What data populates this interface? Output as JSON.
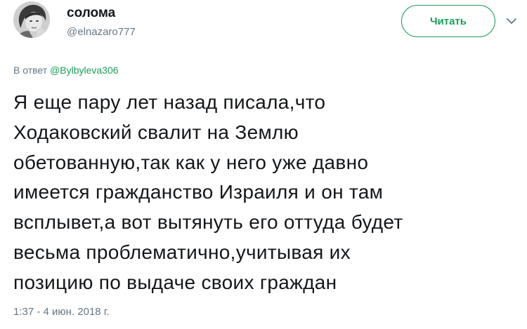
{
  "author": {
    "display_name": "солома",
    "handle": "@elnazaro777",
    "avatar_icon": "grayscale-portrait-avatar"
  },
  "follow_button": {
    "label": "Читать",
    "color": "#1b9e5a"
  },
  "menu_icon": "chevron-down-icon",
  "reply": {
    "prefix": "В ответ",
    "mention": "@Bylbyleva306"
  },
  "tweet": {
    "text": "Я еще пару лет назад писала,что\nХодаковский свалит на Землю\nобетованную,так как у него уже давно\nимеется гражданство Израиля и он там\nвсплывет,а вот вытянуть его оттуда будет\nвесьма проблематично,учитывая их\nпозицию по выдаче своих граждан",
    "timestamp": "1:37 - 4 июн. 2018 г."
  },
  "colors": {
    "accent": "#1b9e5a",
    "text": "#14171a",
    "muted": "#657786"
  }
}
